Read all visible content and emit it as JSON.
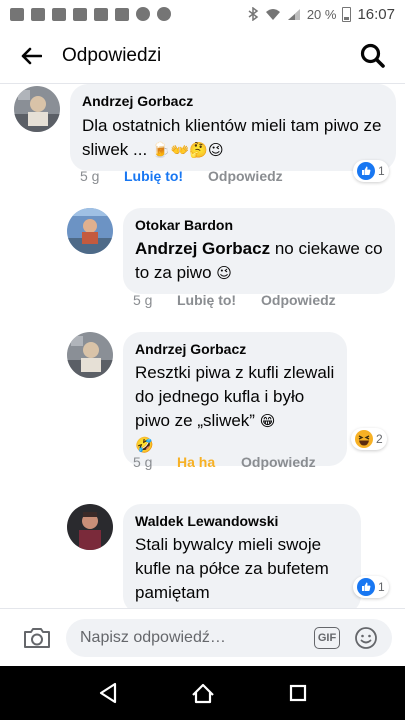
{
  "status_bar": {
    "battery": "20 %",
    "time": "16:07"
  },
  "header": {
    "title": "Odpowiedzi",
    "back_icon": "arrow-left-icon",
    "search_icon": "search-icon"
  },
  "comments": [
    {
      "author": "Andrzej Gorbacz",
      "text": "Dla ostatnich klientów mieli tam piwo ze sliwek ...",
      "emojis": "🍺👐🤔😉",
      "age": "5 g",
      "like_label": "Lubię to!",
      "like_active": true,
      "reply_label": "Odpowiedz",
      "reaction_icon": "thumbs-up-icon",
      "reaction_count": "1"
    },
    {
      "author": "Otokar Bardon",
      "mention": "Andrzej Gorbacz",
      "text": " no ciekawe co to za piwo",
      "emojis": "😉",
      "age": "5 g",
      "like_label": "Lubię to!",
      "like_active": false,
      "reply_label": "Odpowiedz"
    },
    {
      "author": "Andrzej Gorbacz",
      "text": "Resztki piwa z kufli zlewali do jednego kufla i było piwo ze „sliwek”",
      "emojis": "😁",
      "emoji_line2": "🤣",
      "age": "5 g",
      "like_label": "Ha ha",
      "reply_label": "Odpowiedz",
      "reaction_icon": "laughing-emoji-icon",
      "reaction_count": "2"
    },
    {
      "author": "Waldek Lewandowski",
      "text": "Stali bywalcy mieli swoje kufle na półce za bufetem pamiętam",
      "reaction_icon": "thumbs-up-icon",
      "reaction_count": "1"
    }
  ],
  "composer": {
    "placeholder": "Napisz odpowiedź…",
    "gif_label": "GIF"
  },
  "colors": {
    "accent": "#1877f2",
    "bubble": "#f0f2f5",
    "muted": "#8a8d91",
    "haha": "#f7b125"
  }
}
